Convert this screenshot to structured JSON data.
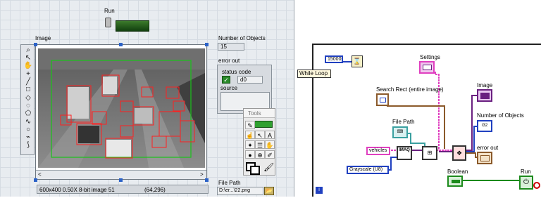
{
  "front_panel": {
    "run_label": "Run",
    "image_label": "Image",
    "num_objects_label": "Number of Objects",
    "num_objects_value": "15",
    "error_out_label": "error out",
    "status_label": "status",
    "code_label": "code",
    "code_value": "d0",
    "source_label": "source",
    "file_path_label": "File Path",
    "file_path_value": "D:\\er...\\22.png",
    "image_info": "600x400 0.50X 8-bit image 51",
    "image_coords": "(64,296)",
    "tools_title": "Tools",
    "scroll_left": "<",
    "scroll_right": ">",
    "colors": {
      "run_button": "#1f5d1f",
      "overlay_rect": "#ff2020",
      "search_rect": "#19c419"
    }
  },
  "block_diagram": {
    "timeout_value": "15000",
    "while_loop_label": "While Loop",
    "settings_label": "Settings",
    "search_rect_label": "Search Rect (entire image)",
    "file_path_label": "File Path",
    "image_label": "Image",
    "num_objects_label": "Number of Objects",
    "num_objects_glyph": "I32",
    "error_out_label": "error out",
    "vehicles_label": "vehicles",
    "imaq_label": "IMAQ",
    "image_type_value": "Grayscale (U8)",
    "boolean_label": "Boolean",
    "run_label": "Run",
    "loop_index": "i",
    "colors": {
      "cluster_wire": "#e040c0",
      "error_wire": "#8b5a2b",
      "path_wire": "#3aa0a0",
      "numeric_wire": "#2040c0",
      "image_wire": "#6a2080"
    }
  }
}
